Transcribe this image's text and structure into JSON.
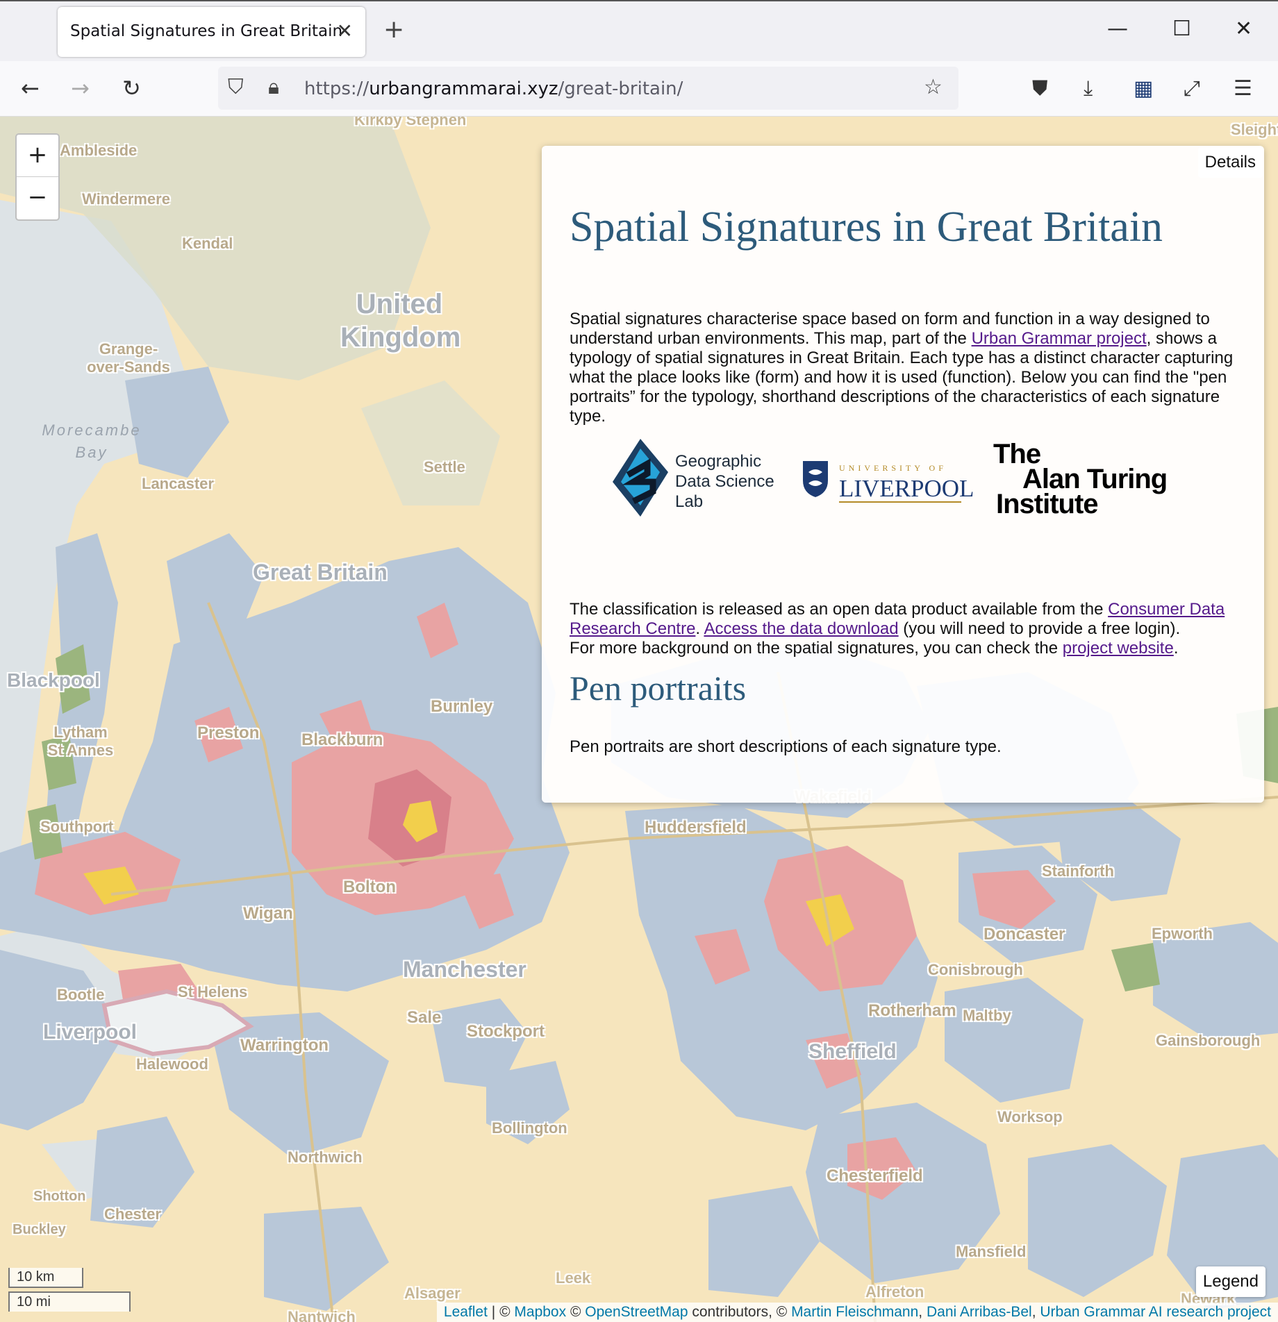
{
  "browser": {
    "tab_title": "Spatial Signatures in Great Britain",
    "url_scheme": "https://",
    "url_host": "urbangrammarai.xyz",
    "url_path": "/great-britain/",
    "icons": [
      "back-arrow-icon",
      "forward-arrow-icon",
      "reload-icon",
      "shield-icon",
      "lock-icon",
      "star-icon",
      "pocket-icon",
      "download-icon",
      "extension-icon",
      "fullscreen-icon",
      "menu-icon"
    ]
  },
  "map": {
    "zoom_in": "+",
    "zoom_out": "−",
    "scale_km": "10 km",
    "scale_mi": "10 mi",
    "legend_label": "Legend",
    "colors": {
      "land": "#f6e5bd",
      "urban_blue": "#b8c7d8",
      "urban_red": "#e8a3a3",
      "green": "#9bb57e",
      "water": "#dde3e6"
    },
    "places": [
      {
        "name": "Ambleside"
      },
      {
        "name": "Windermere"
      },
      {
        "name": "Kendal"
      },
      {
        "name": "Grange-over-Sands"
      },
      {
        "name": "Morecambe Bay"
      },
      {
        "name": "Lancaster"
      },
      {
        "name": "Settle"
      },
      {
        "name": "United Kingdom"
      },
      {
        "name": "Great Britain"
      },
      {
        "name": "Blackpool"
      },
      {
        "name": "Lytham St Annes"
      },
      {
        "name": "Preston"
      },
      {
        "name": "Blackburn"
      },
      {
        "name": "Burnley"
      },
      {
        "name": "Southport"
      },
      {
        "name": "Bolton"
      },
      {
        "name": "Wigan"
      },
      {
        "name": "Manchester"
      },
      {
        "name": "Bootle"
      },
      {
        "name": "St Helens"
      },
      {
        "name": "Liverpool"
      },
      {
        "name": "Halewood"
      },
      {
        "name": "Warrington"
      },
      {
        "name": "Sale"
      },
      {
        "name": "Stockport"
      },
      {
        "name": "Bollington"
      },
      {
        "name": "Northwich"
      },
      {
        "name": "Shotton"
      },
      {
        "name": "Chester"
      },
      {
        "name": "Buckley"
      },
      {
        "name": "Leek"
      },
      {
        "name": "Alsager"
      },
      {
        "name": "Nantwich"
      },
      {
        "name": "Huddersfield"
      },
      {
        "name": "Wakefield"
      },
      {
        "name": "Stainforth"
      },
      {
        "name": "Doncaster"
      },
      {
        "name": "Epworth"
      },
      {
        "name": "Conisbrough"
      },
      {
        "name": "Rotherham"
      },
      {
        "name": "Maltby"
      },
      {
        "name": "Sheffield"
      },
      {
        "name": "Gainsborough"
      },
      {
        "name": "Worksop"
      },
      {
        "name": "Chesterfield"
      },
      {
        "name": "Mansfield"
      },
      {
        "name": "Alfreton"
      },
      {
        "name": "Sleights"
      },
      {
        "name": "Kirkby Stephen"
      },
      {
        "name": "Newark"
      }
    ]
  },
  "attribution": {
    "leaflet": "Leaflet",
    "sep1": " | © ",
    "mapbox": "Mapbox",
    "sep2": " © ",
    "osm": "OpenStreetMap",
    "sep3": " contributors, © ",
    "author1": "Martin Fleischmann",
    "sep4": ", ",
    "author2": "Dani Arribas-Bel",
    "sep5": ", ",
    "project": "Urban Grammar AI research project"
  },
  "panel": {
    "details_label": "Details",
    "title": "Spatial Signatures in Great Britain",
    "intro_1": "Spatial signatures characterise space based on form and function in a way designed to understand urban environments. This map, part of the ",
    "intro_link": "Urban Grammar project",
    "intro_2": ", shows a typology of spatial signatures in Great Britain. Each type has a distinct character capturing what the place looks like (form) and how it is used (function). Below you can find the \"pen portraits” for the typology, shorthand descriptions of the characteristics of each signature type.",
    "logos": {
      "gdsl_line1": "Geographic",
      "gdsl_line2": "Data Science",
      "gdsl_line3": "Lab",
      "liverpool_small": "UNIVERSITY OF",
      "liverpool_big": "LIVERPOOL",
      "turing_line1": "The",
      "turing_line2": "Alan Turing",
      "turing_line3": "Institute"
    },
    "data_1": "The classification is released as an open data product available from the ",
    "data_link1": "Consumer Data Research Centre",
    "data_2": ". ",
    "data_link2": "Access the data download",
    "data_3": " (you will need to provide a free login).",
    "data_4": "For more background on the spatial signatures, you can check the ",
    "data_link3": "project website",
    "data_5": ".",
    "pen_title": "Pen portraits",
    "pen_text": "Pen portraits are short descriptions of each signature type."
  }
}
